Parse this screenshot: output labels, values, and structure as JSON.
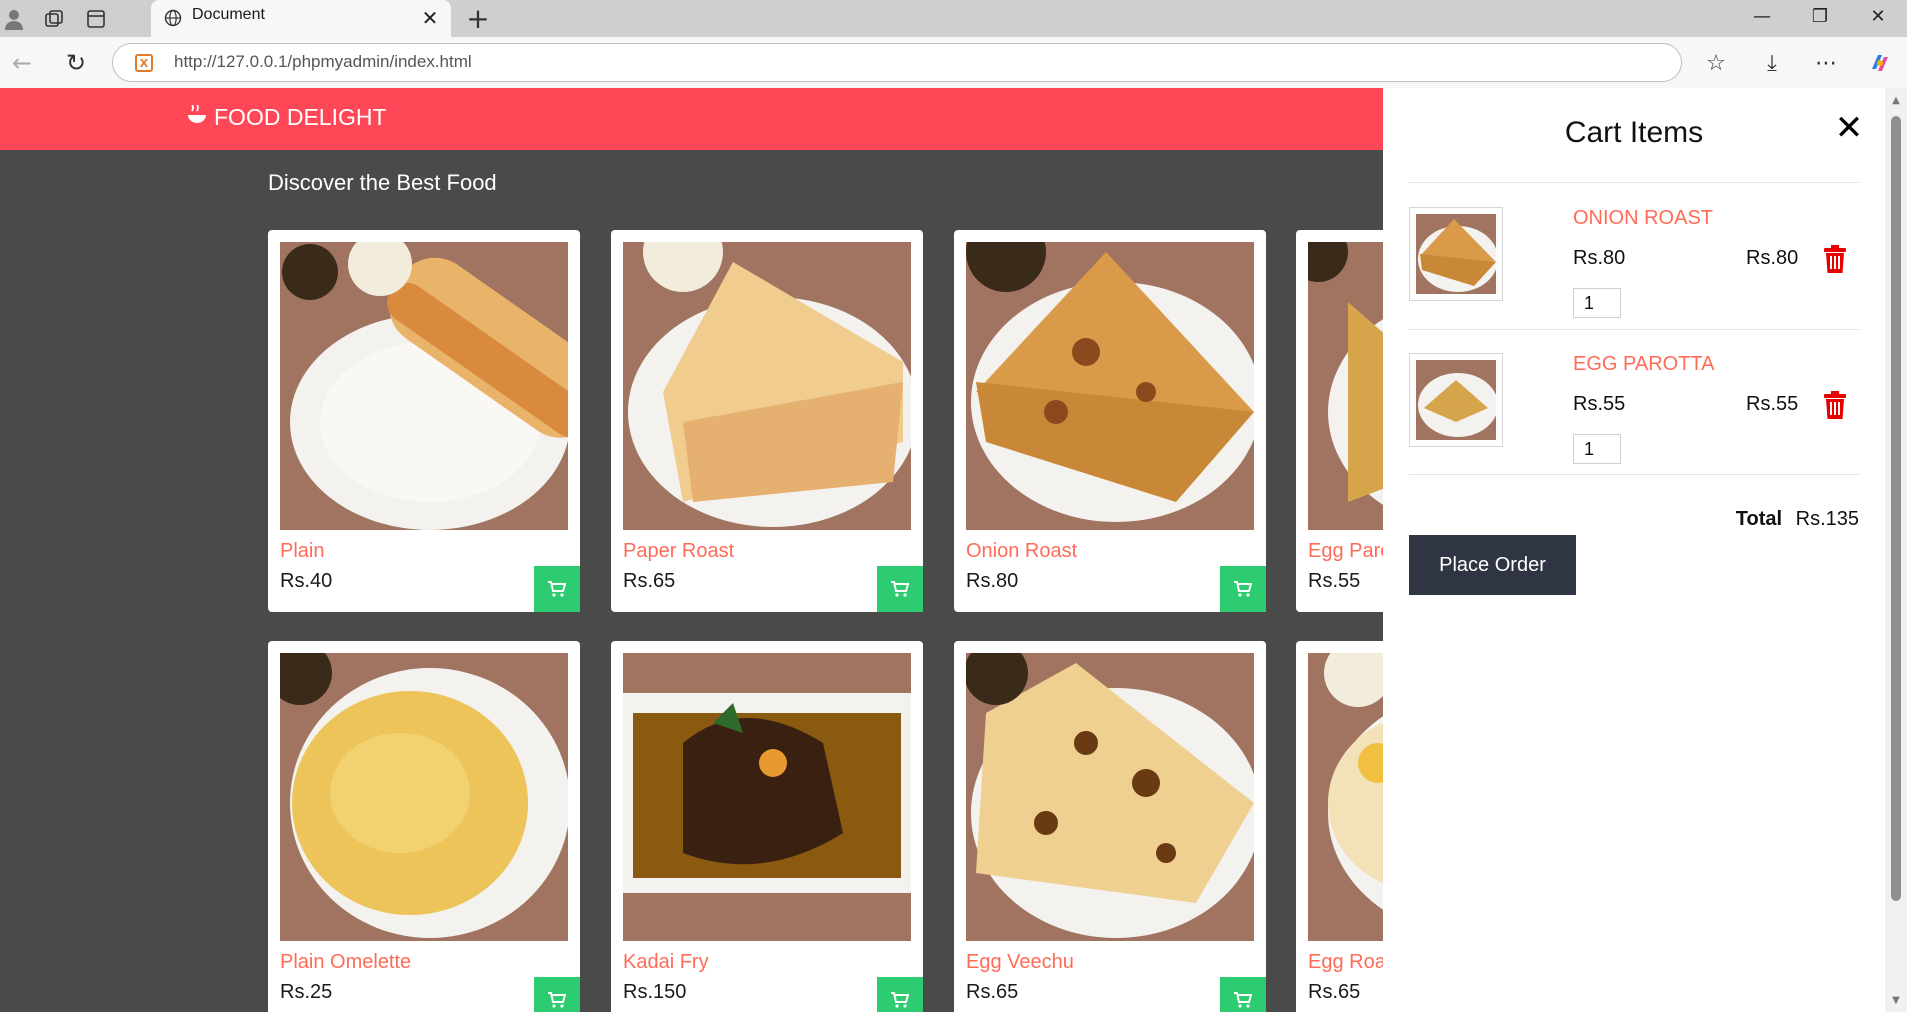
{
  "browser": {
    "tab_title": "Document",
    "url": "http://127.0.0.1/phpmyadmin/index.html"
  },
  "site": {
    "brand": "FOOD DELIGHT",
    "section_title": "Discover the Best Food",
    "accent_color": "#ff4757",
    "cart_button_color": "#2ecc71"
  },
  "menu": [
    {
      "name": "Plain",
      "price": "Rs.40",
      "image": "plain-dosa"
    },
    {
      "name": "Paper Roast",
      "price": "Rs.65",
      "image": "paper-roast"
    },
    {
      "name": "Onion Roast",
      "price": "Rs.80",
      "image": "onion-roast"
    },
    {
      "name": "Egg Parotta",
      "price": "Rs.55",
      "image": "egg-parotta"
    },
    {
      "name": "Plain Omelette",
      "price": "Rs.25",
      "image": "omelette"
    },
    {
      "name": "Kadai Fry",
      "price": "Rs.150",
      "image": "kadai-fry"
    },
    {
      "name": "Egg Veechu",
      "price": "Rs.65",
      "image": "egg-veechu"
    },
    {
      "name": "Egg Roast",
      "price": "Rs.65",
      "image": "egg-roast"
    }
  ],
  "cart": {
    "title": "Cart Items",
    "items": [
      {
        "name": "ONION ROAST",
        "price": "Rs.80",
        "subtotal": "Rs.80",
        "quantity": "1",
        "image": "onion-roast"
      },
      {
        "name": "EGG PAROTTA",
        "price": "Rs.55",
        "subtotal": "Rs.55",
        "quantity": "1",
        "image": "egg-parotta"
      }
    ],
    "total_label": "Total",
    "total_value": "Rs.135",
    "place_order_label": "Place Order"
  }
}
